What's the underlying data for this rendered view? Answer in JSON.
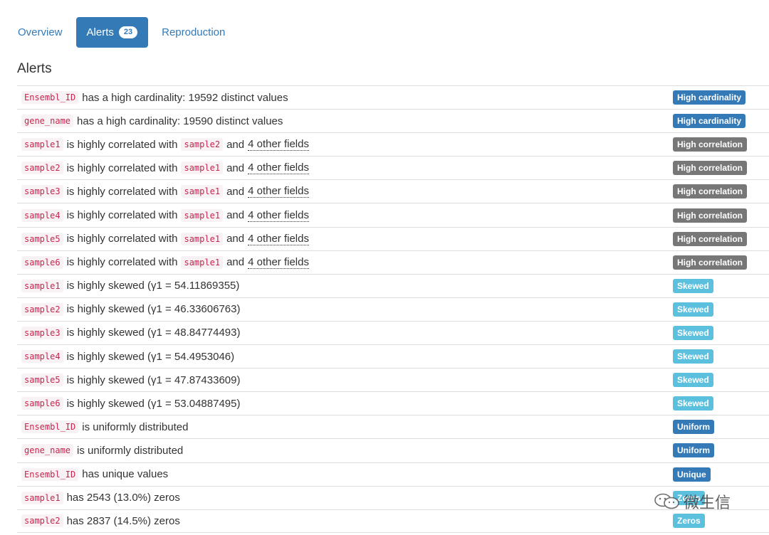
{
  "tabs": [
    {
      "label": "Overview",
      "active": false
    },
    {
      "label": "Alerts",
      "active": true,
      "badge": "23"
    },
    {
      "label": "Reproduction",
      "active": false
    }
  ],
  "section_title": "Alerts",
  "colors": {
    "primary": "#337ab7",
    "default": "#777777",
    "info": "#5bc0de",
    "code_text": "#c7254e",
    "code_bg": "#f9f2f4"
  },
  "alerts": [
    {
      "field": "Ensembl_ID",
      "text": "has a high cardinality: 19592 distinct values",
      "label": "High cardinality"
    },
    {
      "field": "gene_name",
      "text": "has a high cardinality: 19590 distinct values",
      "label": "High cardinality"
    },
    {
      "field": "sample1",
      "text": "is highly correlated with",
      "field2": "sample2",
      "text2": "and",
      "link": "4 other fields",
      "label": "High correlation"
    },
    {
      "field": "sample2",
      "text": "is highly correlated with",
      "field2": "sample1",
      "text2": "and",
      "link": "4 other fields",
      "label": "High correlation"
    },
    {
      "field": "sample3",
      "text": "is highly correlated with",
      "field2": "sample1",
      "text2": "and",
      "link": "4 other fields",
      "label": "High correlation"
    },
    {
      "field": "sample4",
      "text": "is highly correlated with",
      "field2": "sample1",
      "text2": "and",
      "link": "4 other fields",
      "label": "High correlation"
    },
    {
      "field": "sample5",
      "text": "is highly correlated with",
      "field2": "sample1",
      "text2": "and",
      "link": "4 other fields",
      "label": "High correlation"
    },
    {
      "field": "sample6",
      "text": "is highly correlated with",
      "field2": "sample1",
      "text2": "and",
      "link": "4 other fields",
      "label": "High correlation"
    },
    {
      "field": "sample1",
      "text": "is highly skewed (γ1 = 54.11869355)",
      "label": "Skewed"
    },
    {
      "field": "sample2",
      "text": "is highly skewed (γ1 = 46.33606763)",
      "label": "Skewed"
    },
    {
      "field": "sample3",
      "text": "is highly skewed (γ1 = 48.84774493)",
      "label": "Skewed"
    },
    {
      "field": "sample4",
      "text": "is highly skewed (γ1 = 54.4953046)",
      "label": "Skewed"
    },
    {
      "field": "sample5",
      "text": "is highly skewed (γ1 = 47.87433609)",
      "label": "Skewed"
    },
    {
      "field": "sample6",
      "text": "is highly skewed (γ1 = 53.04887495)",
      "label": "Skewed"
    },
    {
      "field": "Ensembl_ID",
      "text": "is uniformly distributed",
      "label": "Uniform"
    },
    {
      "field": "gene_name",
      "text": "is uniformly distributed",
      "label": "Uniform"
    },
    {
      "field": "Ensembl_ID",
      "text": "has unique values",
      "label": "Unique"
    },
    {
      "field": "sample1",
      "text": "has 2543 (13.0%) zeros",
      "label": "Zeros"
    },
    {
      "field": "sample2",
      "text": "has 2837 (14.5%) zeros",
      "label": "Zeros"
    }
  ],
  "watermark": {
    "text": "微生信",
    "icon": "wechat-icon"
  }
}
